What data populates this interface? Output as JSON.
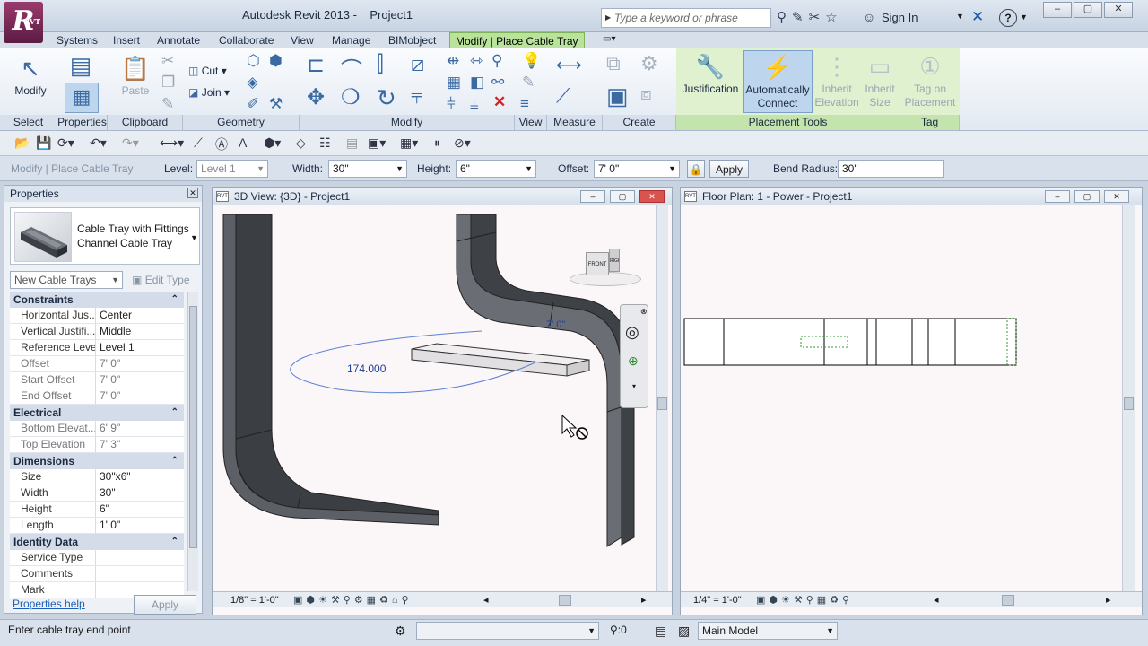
{
  "window": {
    "app_title": "Autodesk Revit 2013 -",
    "project": "Project1",
    "app_letter": "R",
    "app_badge": "RVT",
    "search_placeholder": "Type a keyword or phrase",
    "sign_in": "Sign In",
    "controls": [
      "–",
      "▢",
      "✕"
    ]
  },
  "tabs": [
    "Systems",
    "Insert",
    "Annotate",
    "Collaborate",
    "View",
    "Manage",
    "BIMobject",
    "Modify | Place Cable Tray"
  ],
  "ribbon": {
    "modify": "Modify",
    "paste": "Paste",
    "cut": "Cut",
    "join": "Join",
    "justification": "Justification",
    "automatically_connect": "Automatically Connect",
    "inherit_elevation": "Inherit Elevation",
    "inherit_size": "Inherit Size",
    "tag_on_placement": "Tag on Placement",
    "panels": [
      "Select",
      "Properties",
      "Clipboard",
      "Geometry",
      "Modify",
      "View",
      "Measure",
      "Create",
      "Placement Tools",
      "Tag"
    ]
  },
  "options_bar": {
    "context": "Modify | Place Cable Tray",
    "level_label": "Level:",
    "level_value": "Level 1",
    "width_label": "Width:",
    "width_value": "30\"",
    "height_label": "Height:",
    "height_value": "6\"",
    "offset_label": "Offset:",
    "offset_value": "7'  0\"",
    "apply": "Apply",
    "bend_radius_label": "Bend Radius:",
    "bend_radius_value": "30\""
  },
  "properties": {
    "title": "Properties",
    "type_name_1": "Cable Tray with Fittings",
    "type_name_2": "Channel Cable Tray",
    "instance": "New Cable Trays",
    "edit_type": "Edit Type",
    "groups": [
      {
        "name": "Constraints",
        "rows": [
          {
            "k": "Horizontal Jus...",
            "v": "Center"
          },
          {
            "k": "Vertical Justifi...",
            "v": "Middle"
          },
          {
            "k": "Reference Level",
            "v": "Level 1"
          },
          {
            "k": "Offset",
            "v": "7'  0\""
          },
          {
            "k": "Start Offset",
            "v": "7'  0\""
          },
          {
            "k": "End Offset",
            "v": "7'  0\""
          }
        ]
      },
      {
        "name": "Electrical",
        "rows": [
          {
            "k": "Bottom Elevat...",
            "v": "6'  9\""
          },
          {
            "k": "Top Elevation",
            "v": "7'  3\""
          }
        ]
      },
      {
        "name": "Dimensions",
        "rows": [
          {
            "k": "Size",
            "v": "30\"x6\""
          },
          {
            "k": "Width",
            "v": "30\""
          },
          {
            "k": "Height",
            "v": "6\""
          },
          {
            "k": "Length",
            "v": "1'  0\""
          }
        ]
      },
      {
        "name": "Identity Data",
        "rows": [
          {
            "k": "Service Type",
            "v": ""
          },
          {
            "k": "Comments",
            "v": ""
          },
          {
            "k": "Mark",
            "v": ""
          }
        ]
      }
    ],
    "help_link": "Properties help",
    "apply": "Apply"
  },
  "view3d": {
    "title": "3D View: {3D} - Project1",
    "dimension": "174.000'",
    "elev_tag": "7' 0\"",
    "scale": "1/8\" = 1'-0\"",
    "cube_front": "FRONT",
    "cube_right": "RIGHT"
  },
  "floorplan": {
    "title": "Floor Plan: 1 - Power - Project1",
    "scale": "1/4\" = 1'-0\""
  },
  "status": {
    "prompt": "Enter cable tray end point",
    "count": ":0",
    "workset": "Main Model"
  }
}
